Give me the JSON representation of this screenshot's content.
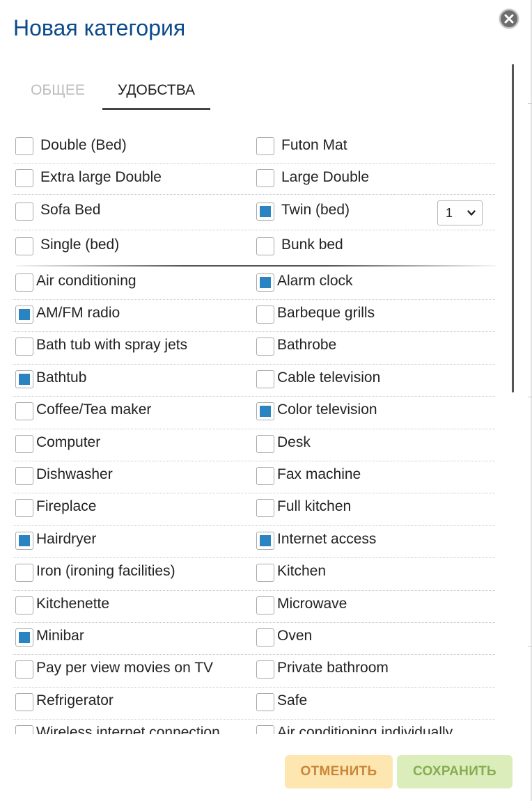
{
  "dialog": {
    "title": "Новая категория"
  },
  "tabs": [
    {
      "label": "ОБЩЕЕ",
      "active": false
    },
    {
      "label": "УДОБСТВА",
      "active": true
    }
  ],
  "beds": [
    {
      "left": {
        "label": "Double (Bed)",
        "checked": false
      },
      "right": {
        "label": "Futon Mat",
        "checked": false
      }
    },
    {
      "left": {
        "label": "Extra large Double",
        "checked": false
      },
      "right": {
        "label": "Large Double",
        "checked": false
      }
    },
    {
      "left": {
        "label": "Sofa Bed",
        "checked": false
      },
      "right": {
        "label": "Twin (bed)",
        "checked": true,
        "quantity": "1"
      }
    },
    {
      "left": {
        "label": "Single (bed)",
        "checked": false
      },
      "right": {
        "label": "Bunk bed",
        "checked": false
      }
    }
  ],
  "amenities": [
    {
      "left": {
        "label": "Air conditioning",
        "checked": false
      },
      "right": {
        "label": "Alarm clock",
        "checked": true
      }
    },
    {
      "left": {
        "label": "AM/FM radio",
        "checked": true
      },
      "right": {
        "label": "Barbeque grills",
        "checked": false
      }
    },
    {
      "left": {
        "label": "Bath tub with spray jets",
        "checked": false
      },
      "right": {
        "label": "Bathrobe",
        "checked": false
      }
    },
    {
      "left": {
        "label": "Bathtub",
        "checked": true
      },
      "right": {
        "label": "Cable television",
        "checked": false
      }
    },
    {
      "left": {
        "label": "Coffee/Tea maker",
        "checked": false
      },
      "right": {
        "label": "Color television",
        "checked": true
      }
    },
    {
      "left": {
        "label": "Computer",
        "checked": false
      },
      "right": {
        "label": "Desk",
        "checked": false
      }
    },
    {
      "left": {
        "label": "Dishwasher",
        "checked": false
      },
      "right": {
        "label": "Fax machine",
        "checked": false
      }
    },
    {
      "left": {
        "label": "Fireplace",
        "checked": false
      },
      "right": {
        "label": "Full kitchen",
        "checked": false
      }
    },
    {
      "left": {
        "label": "Hairdryer",
        "checked": true
      },
      "right": {
        "label": "Internet access",
        "checked": true
      }
    },
    {
      "left": {
        "label": "Iron (ironing facilities)",
        "checked": false
      },
      "right": {
        "label": "Kitchen",
        "checked": false
      }
    },
    {
      "left": {
        "label": "Kitchenette",
        "checked": false
      },
      "right": {
        "label": "Microwave",
        "checked": false
      }
    },
    {
      "left": {
        "label": "Minibar",
        "checked": true
      },
      "right": {
        "label": "Oven",
        "checked": false
      }
    },
    {
      "left": {
        "label": "Pay per view movies on TV",
        "checked": false
      },
      "right": {
        "label": "Private bathroom",
        "checked": false
      }
    },
    {
      "left": {
        "label": "Refrigerator",
        "checked": false
      },
      "right": {
        "label": "Safe",
        "checked": false
      }
    },
    {
      "left": {
        "label": "Wireless internet connection",
        "checked": false
      },
      "right": {
        "label": "Air conditioning individually",
        "checked": false
      }
    }
  ],
  "buttons": {
    "cancel": "ОТМЕНИТЬ",
    "save": "СОХРАНИТЬ"
  },
  "colors": {
    "title": "#0b4a8b",
    "checkbox_fill": "#2b84c2",
    "cancel_bg": "#fde6b0",
    "cancel_text": "#c9873a",
    "save_bg": "#dcedbc",
    "save_text": "#86ad52"
  },
  "icons": {
    "close": "close-circle-icon",
    "select_arrow": "chevron-down-icon"
  }
}
